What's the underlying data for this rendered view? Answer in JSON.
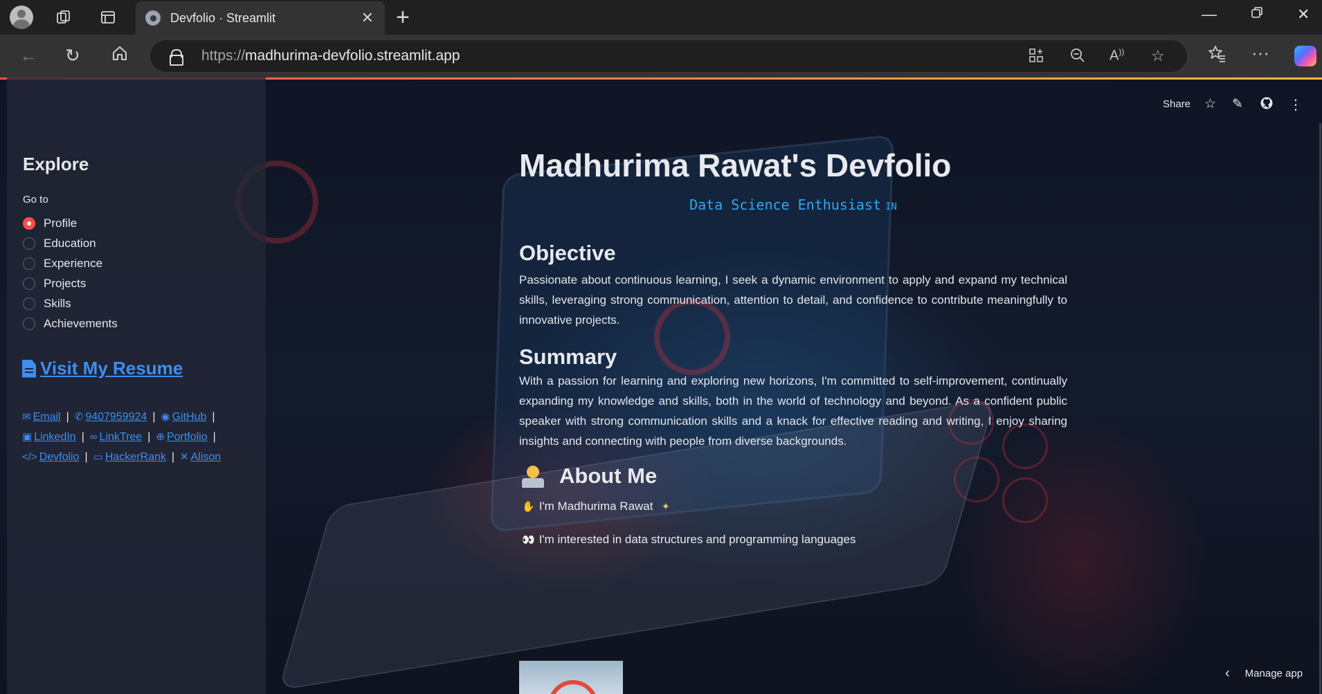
{
  "browser": {
    "tab_title": "Devfolio · Streamlit",
    "url_protocol": "https://",
    "url_host": "madhurima-devfolio.streamlit.app"
  },
  "toolbar": {
    "share_label": "Share"
  },
  "sidebar": {
    "title": "Explore",
    "goto_label": "Go to",
    "nav_items": [
      {
        "label": "Profile",
        "selected": true
      },
      {
        "label": "Education",
        "selected": false
      },
      {
        "label": "Experience",
        "selected": false
      },
      {
        "label": "Projects",
        "selected": false
      },
      {
        "label": "Skills",
        "selected": false
      },
      {
        "label": "Achievements",
        "selected": false
      }
    ],
    "resume_label": "Visit My Resume",
    "links": {
      "email": "Email",
      "phone": "9407959924",
      "github": "GitHub",
      "linkedin": "LinkedIn",
      "linktree": "LinkTree",
      "portfolio": "Portfolio",
      "devfolio": "Devfolio",
      "hackerrank": "HackerRank",
      "alison": "Alison"
    }
  },
  "main": {
    "title": "Madhurima Rawat's Devfolio",
    "subtitle": "Data Science Enthusiast",
    "subtitle_tag": "IN",
    "objective_heading": "Objective",
    "objective_text": "Passionate about continuous learning, I seek a dynamic environment to apply and expand my technical skills, leveraging strong communication, attention to detail, and confidence to contribute meaningfully to innovative projects.",
    "summary_heading": "Summary",
    "summary_text": "With a passion for learning and exploring new horizons, I'm committed to self-improvement, continually expanding my knowledge and skills, both in the world of technology and beyond. As a confident public speaker with strong communication skills and a knack for effective reading and writing, I enjoy sharing insights and connecting with people from diverse backgrounds.",
    "about_heading": "About Me",
    "about_lines": [
      "I'm Madhurima Rawat",
      "I'm interested in data structures and programming languages"
    ]
  },
  "footer": {
    "manage_app": "Manage app"
  },
  "colors": {
    "accent_red": "#ff4b4b",
    "link_blue": "#3d8ef0",
    "subtitle_blue": "#2fa8f0"
  }
}
